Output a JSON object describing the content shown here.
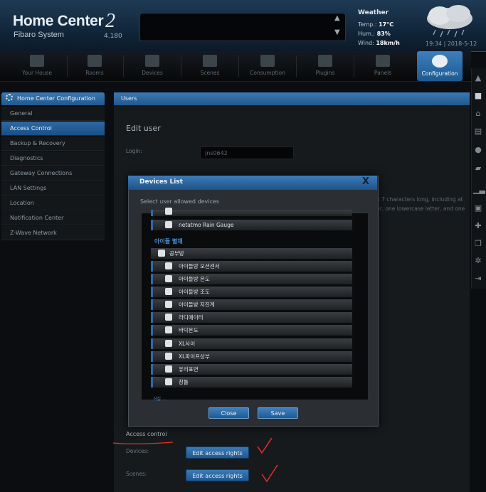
{
  "brand": {
    "title": "Home Center",
    "number": "2",
    "subtitle": "Fibaro System",
    "version": "4.180"
  },
  "weather": {
    "title": "Weather",
    "temp_label": "Temp.:",
    "temp_value": "17°C",
    "hum_label": "Hum.:",
    "hum_value": "83%",
    "wind_label": "Wind:",
    "wind_value": "18km/h"
  },
  "datetime": "19:34 | 2018-5-12",
  "nav": [
    {
      "label": "Your House",
      "icon": "house-icon"
    },
    {
      "label": "Rooms",
      "icon": "rooms-icon"
    },
    {
      "label": "Devices",
      "icon": "bulb-icon"
    },
    {
      "label": "Scenes",
      "icon": "scenes-icon"
    },
    {
      "label": "Consumption",
      "icon": "chart-icon"
    },
    {
      "label": "Plugins",
      "icon": "plugin-icon"
    },
    {
      "label": "Panels",
      "icon": "panels-icon"
    },
    {
      "label": "Configuration",
      "icon": "gears-icon",
      "active": true
    }
  ],
  "sidebar": {
    "header": "Home Center Configuration",
    "items": [
      {
        "label": "General"
      },
      {
        "label": "Access Control",
        "selected": true
      },
      {
        "label": "Backup & Recovery"
      },
      {
        "label": "Diagnostics"
      },
      {
        "label": "Gateway Connections"
      },
      {
        "label": "LAN Settings"
      },
      {
        "label": "Location"
      },
      {
        "label": "Notification Center"
      },
      {
        "label": "Z-Wave Network"
      }
    ]
  },
  "main": {
    "header": "Users",
    "edit_title": "Edit user",
    "login_label": "Login:",
    "login_value": "jns0642",
    "pw_hint_1": "st 7 characters long, including at",
    "pw_hint_2": "er, one lowercase letter, and one",
    "access_control_title": "Access control",
    "devices_label": "Devices:",
    "scenes_label": "Scenes:",
    "edit_access_rights": "Edit access rights"
  },
  "modal": {
    "title": "Devices List",
    "close": "X",
    "subtitle": "Select user allowed devices",
    "top_device": "netatmo Rain Gauge",
    "section": "아이들 별채",
    "room": "공부방",
    "devices": [
      "아이들방 모션센서",
      "아이들방 온도",
      "아이들방 조도",
      "아이들방 지진계",
      "라디에이터",
      "바닥온도",
      "XL사이",
      "XL파이프상부",
      "유리표면",
      "창틀"
    ],
    "cut_label": "거실 ...",
    "close_button": "Close",
    "save_button": "Save"
  },
  "colors": {
    "accent": "#2b6aa6",
    "annotation": "#e0302a"
  }
}
